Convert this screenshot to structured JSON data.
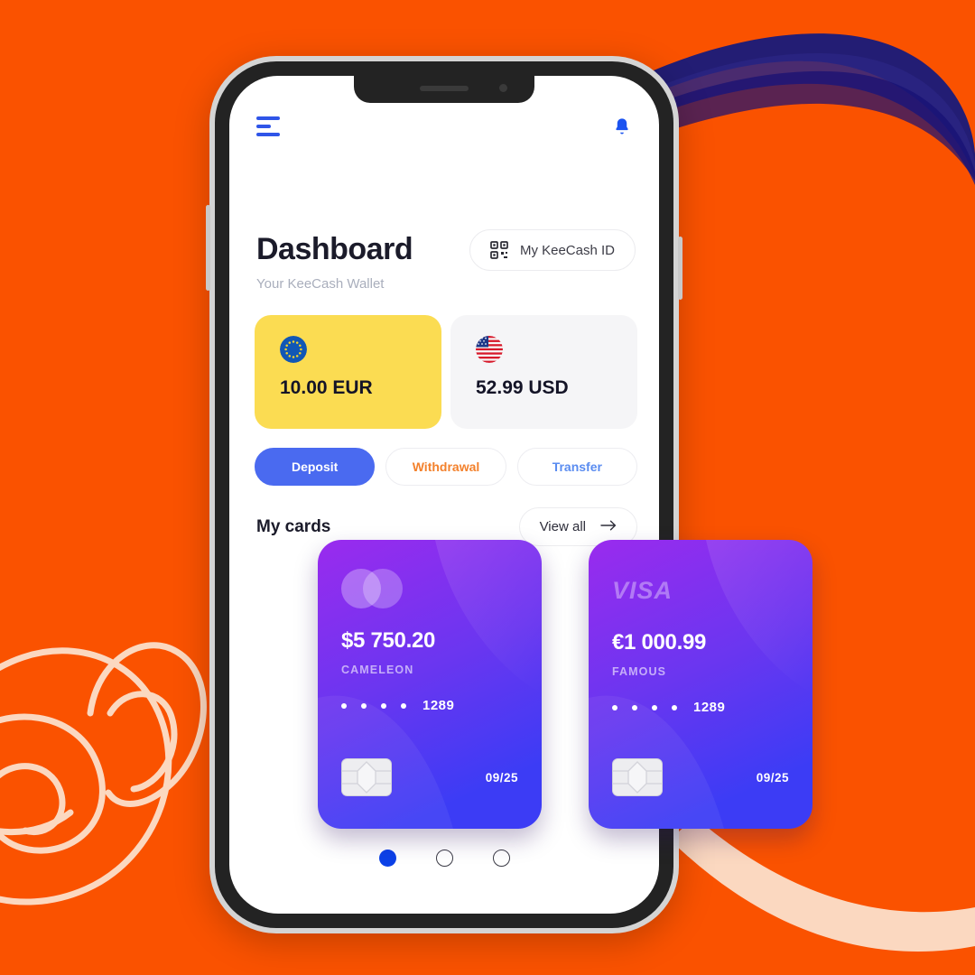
{
  "theme": {
    "background": "#FA5200",
    "accent_blue": "#2F55E8",
    "deposit_blue": "#4A6AF0",
    "withdrawal_orange": "#F3812C",
    "transfer_blue": "#5A8CF0",
    "eur_card_yellow": "#FBDC52",
    "usd_card_grey": "#F5F5F7",
    "swoosh_navy": "#1E1B6E",
    "swoosh_cream": "#FBD8C0"
  },
  "topbar": {
    "menu_icon": "hamburger-menu-icon",
    "notification_icon": "bell-icon"
  },
  "header": {
    "title": "Dashboard",
    "subtitle": "Your KeeCash Wallet",
    "kee_id_button": {
      "label": "My KeeCash ID",
      "icon": "qr-code-icon"
    }
  },
  "wallets": [
    {
      "currency": "EUR",
      "amount": "10.00 EUR",
      "flag": "eu-flag-icon"
    },
    {
      "currency": "USD",
      "amount": "52.99 USD",
      "flag": "us-flag-icon"
    }
  ],
  "actions": [
    {
      "label": "Deposit",
      "style": "primary"
    },
    {
      "label": "Withdrawal",
      "style": "ghost-orange"
    },
    {
      "label": "Transfer",
      "style": "ghost-blue"
    }
  ],
  "cards_section": {
    "title": "My cards",
    "view_all_label": "View all",
    "view_all_icon": "arrow-right-icon"
  },
  "cards": [
    {
      "brand": "mastercard",
      "brand_label": "",
      "amount": "$5 750.20",
      "owner": "CAMELEON",
      "masked": "• • • •",
      "last4": "1289",
      "expiry": "09/25",
      "chip_icon": "card-chip-icon"
    },
    {
      "brand": "visa",
      "brand_label": "VISA",
      "amount": "€1 000.99",
      "owner": "FAMOUS",
      "masked": "• • • •",
      "last4": "1289",
      "expiry": "09/25",
      "chip_icon": "card-chip-icon"
    }
  ],
  "pagination": {
    "total": 3,
    "active_index": 0
  }
}
